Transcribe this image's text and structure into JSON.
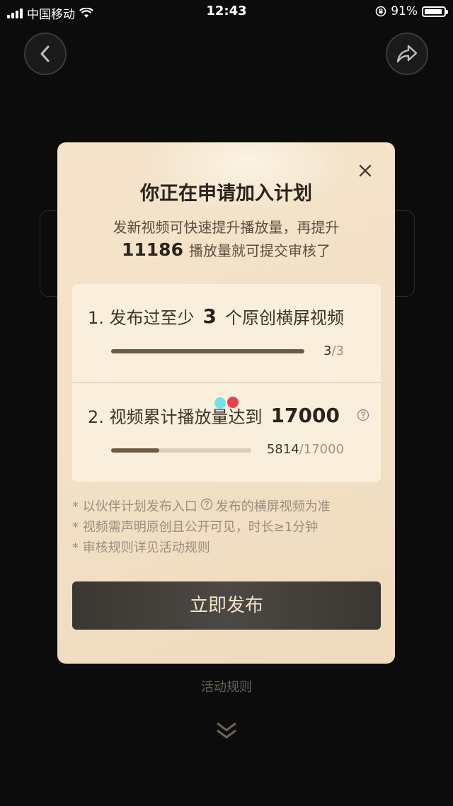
{
  "status_bar": {
    "carrier": "中国移动",
    "time": "12:43",
    "battery": "91%",
    "battery_level": 0.91
  },
  "nav": {
    "back_icon": "chevron-left-icon",
    "share_icon": "share-icon"
  },
  "modal": {
    "title": "你正在申请加入计划",
    "subtitle_line1": "发新视频可快速提升播放量，再提升",
    "subtitle_number": "11186",
    "subtitle_line2_suffix": "播放量就可提交审核了",
    "close_icon": "close-icon",
    "requirements": [
      {
        "prefix": "1. 发布过至少",
        "highlight": "3",
        "suffix": "个原创横屏视频",
        "current": "3",
        "total": "/3",
        "progress": 1.0
      },
      {
        "prefix": "2. 视频累计播放量达到",
        "highlight": "17000",
        "suffix": "",
        "current": "5814",
        "total": "/17000",
        "progress": 0.342
      }
    ],
    "notes": [
      "* 以伙伴计划发布入口",
      "发布的横屏视频为准",
      "* 视频需声明原创且公开可见，时长≥1分钟",
      "* 审核规则详见活动规则"
    ],
    "publish_button": "立即发布"
  },
  "footer": {
    "rules_link": "活动规则",
    "down_icon": "double-chevron-down-icon"
  },
  "colors": {
    "accent_dark": "#6e5a44",
    "modal_bg": "#f3e2c8",
    "button_bg": "#45413d",
    "button_text": "#f3e3c8"
  }
}
